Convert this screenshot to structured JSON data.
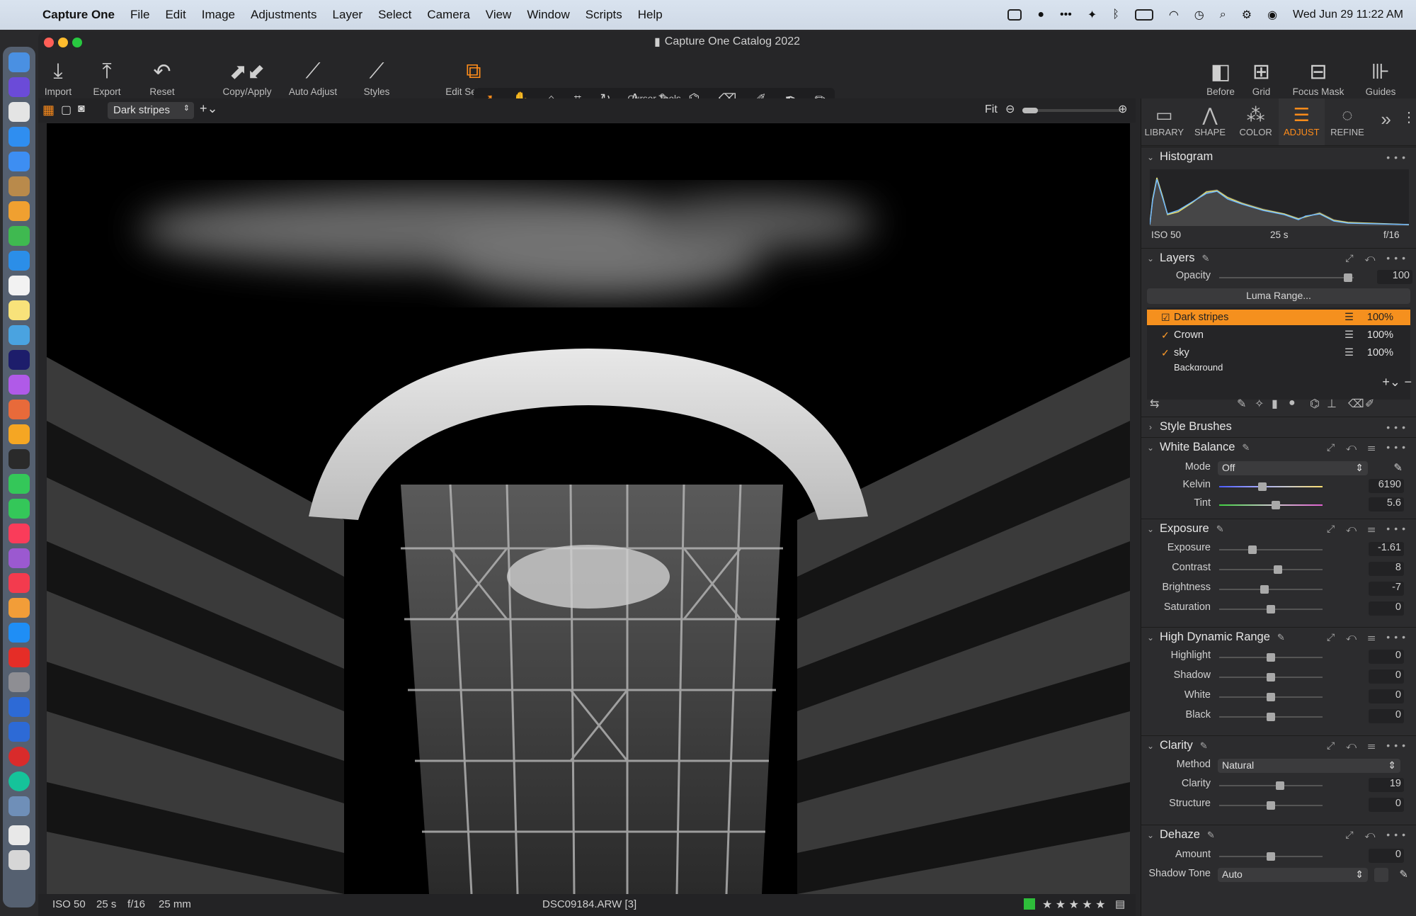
{
  "menubar": {
    "app_name": "Capture One",
    "items": [
      "File",
      "Edit",
      "Image",
      "Adjustments",
      "Layer",
      "Select",
      "Camera",
      "View",
      "Window",
      "Scripts",
      "Help"
    ],
    "clock": "Wed Jun 29  11:22 AM"
  },
  "window": {
    "title": "Capture One Catalog 2022"
  },
  "toolbar": {
    "import": "Import",
    "export": "Export",
    "reset": "Reset",
    "copy_apply": "Copy/Apply",
    "auto_adjust": "Auto Adjust",
    "styles": "Styles",
    "edit_selected": "Edit Selected",
    "cursor_tools": "Cursor Tools",
    "before": "Before",
    "grid": "Grid",
    "focus_mask": "Focus Mask",
    "guides": "Guides"
  },
  "viewbar": {
    "layer_select": "Dark stripes",
    "zoom": "Fit"
  },
  "status": {
    "iso": "ISO 50",
    "shutter": "25 s",
    "aperture": "f/16",
    "focal": "25 mm",
    "filename": "DSC09184.ARW [3]",
    "stars": "★ ★ ★ ★ ★"
  },
  "tabs": [
    "LIBRARY",
    "SHAPE",
    "COLOR",
    "ADJUST",
    "REFINE"
  ],
  "histogram": {
    "title": "Histogram",
    "iso": "ISO 50",
    "shutter": "25 s",
    "aperture": "f/16"
  },
  "layers": {
    "title": "Layers",
    "opacity_label": "Opacity",
    "opacity": "100",
    "luma_range": "Luma Range...",
    "items": [
      {
        "name": "Dark stripes",
        "pct": "100%"
      },
      {
        "name": "Crown",
        "pct": "100%"
      },
      {
        "name": "sky",
        "pct": "100%"
      },
      {
        "name": "Background",
        "pct": ""
      }
    ]
  },
  "style_brushes": {
    "title": "Style Brushes"
  },
  "white_balance": {
    "title": "White Balance",
    "mode_label": "Mode",
    "mode": "Off",
    "kelvin_label": "Kelvin",
    "kelvin": "6190",
    "tint_label": "Tint",
    "tint": "5.6"
  },
  "exposure": {
    "title": "Exposure",
    "rows": [
      {
        "label": "Exposure",
        "value": "-1.61",
        "pos": 0.32
      },
      {
        "label": "Contrast",
        "value": "8",
        "pos": 0.57
      },
      {
        "label": "Brightness",
        "value": "-7",
        "pos": 0.44
      },
      {
        "label": "Saturation",
        "value": "0",
        "pos": 0.5
      }
    ]
  },
  "hdr": {
    "title": "High Dynamic Range",
    "rows": [
      {
        "label": "Highlight",
        "value": "0",
        "pos": 0.5
      },
      {
        "label": "Shadow",
        "value": "0",
        "pos": 0.5
      },
      {
        "label": "White",
        "value": "0",
        "pos": 0.5
      },
      {
        "label": "Black",
        "value": "0",
        "pos": 0.5
      }
    ]
  },
  "clarity": {
    "title": "Clarity",
    "method_label": "Method",
    "method": "Natural",
    "rows": [
      {
        "label": "Clarity",
        "value": "19",
        "pos": 0.59
      },
      {
        "label": "Structure",
        "value": "0",
        "pos": 0.5
      }
    ]
  },
  "dehaze": {
    "title": "Dehaze",
    "amount_label": "Amount",
    "amount": "0",
    "amount_pos": 0.5,
    "shadow_tone_label": "Shadow Tone",
    "shadow_tone": "Auto"
  },
  "colors": {
    "accent": "#ff8c1a",
    "layer_selected": "#f5901e"
  }
}
